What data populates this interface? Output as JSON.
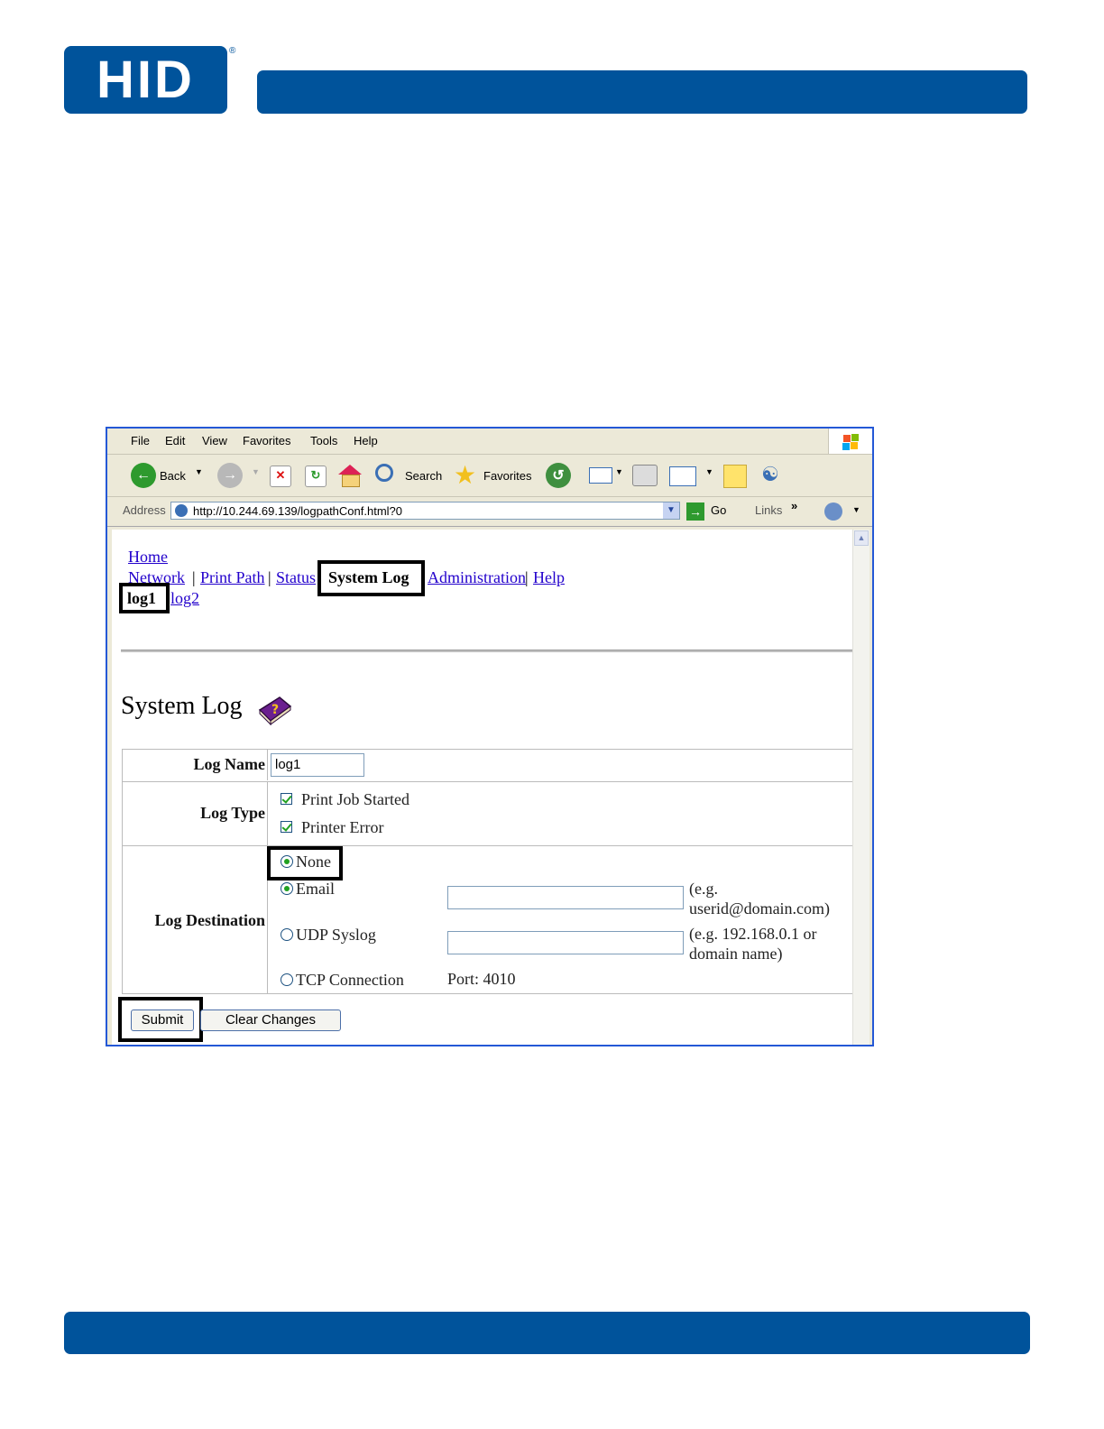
{
  "logo": {
    "text": "HID",
    "reg": "®"
  },
  "browser": {
    "menu": [
      "File",
      "Edit",
      "View",
      "Favorites",
      "Tools",
      "Help"
    ],
    "toolbar": {
      "back": "Back",
      "search": "Search",
      "favorites": "Favorites"
    },
    "address": {
      "label": "Address",
      "url": "http://10.244.69.139/logpathConf.html?0",
      "go": "Go",
      "links": "Links"
    }
  },
  "nav": {
    "home": "Home",
    "network": "Network",
    "print_path": "Print Path",
    "status": "Status",
    "system_log": "System Log",
    "administration": "Administration",
    "help": "Help",
    "sep": "|",
    "log1": "log1",
    "log2": "log2"
  },
  "page_title": "System Log",
  "form": {
    "log_name_label": "Log Name",
    "log_name_value": "log1",
    "log_type_label": "Log Type",
    "log_types": [
      {
        "label": "Print Job Started",
        "checked": true
      },
      {
        "label": "Printer Error",
        "checked": true
      }
    ],
    "log_destination_label": "Log Destination",
    "destinations": {
      "none": "None",
      "email": "Email",
      "email_hint1": "(e.g.",
      "email_hint2": "userid@domain.com)",
      "udp": "UDP Syslog",
      "udp_hint1": "(e.g. 192.168.0.1 or",
      "udp_hint2": "domain name)",
      "tcp": "TCP Connection",
      "port": "Port: 4010"
    },
    "submit": "Submit",
    "clear": "Clear Changes"
  },
  "colors": {
    "brand": "#00539b",
    "highlight": "#000000",
    "xp_frame": "#2458d6"
  }
}
